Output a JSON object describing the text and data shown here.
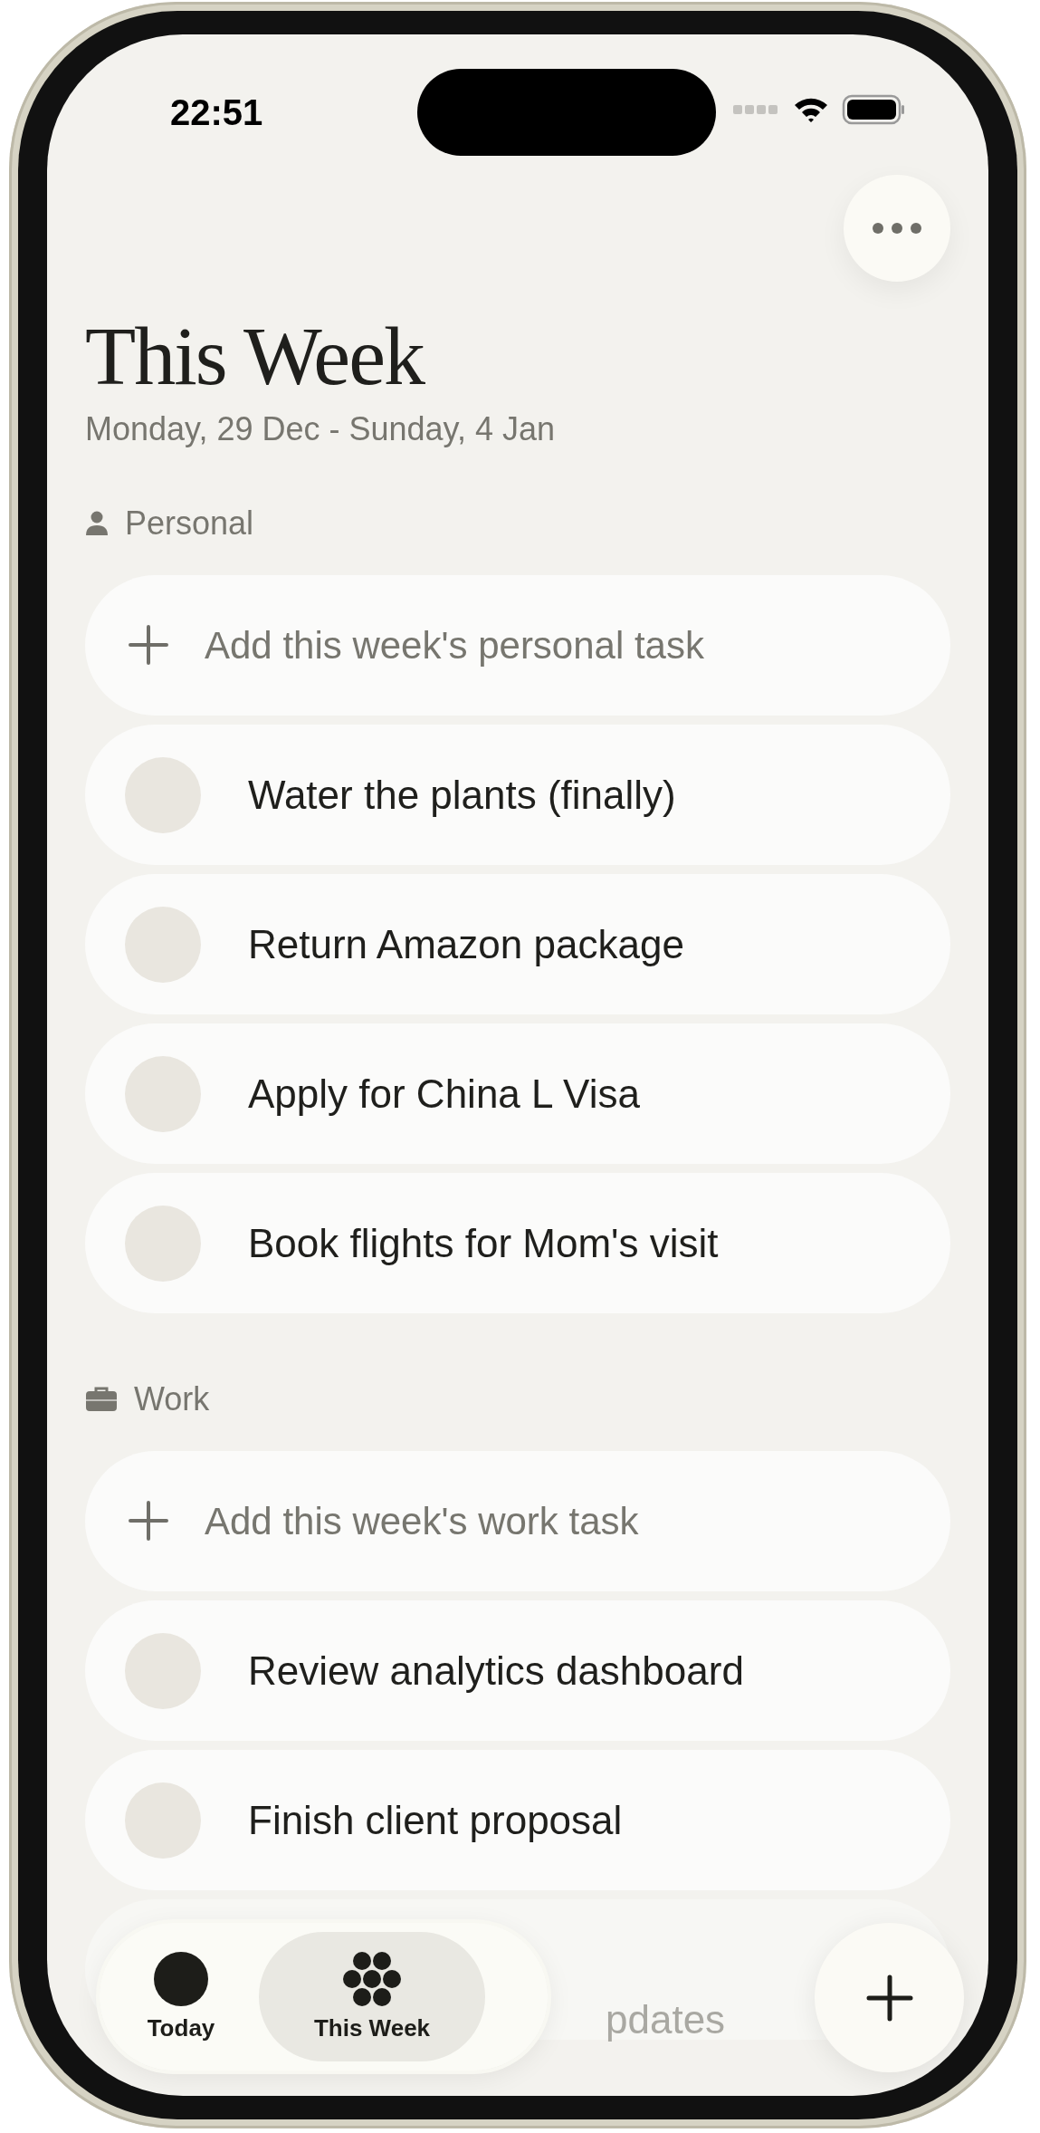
{
  "status_bar": {
    "time": "22:51"
  },
  "header": {
    "title": "This Week",
    "subtitle": "Monday, 29 Dec - Sunday, 4 Jan"
  },
  "sections": [
    {
      "kind": "personal",
      "label": "Personal",
      "placeholder": "Add this week's personal task",
      "tasks": [
        {
          "kind": "task",
          "title": "Water the plants (finally)",
          "done": false
        },
        {
          "kind": "task",
          "title": "Return Amazon package",
          "done": false
        },
        {
          "kind": "task",
          "title": "Apply for China L Visa",
          "done": false
        },
        {
          "kind": "task",
          "title": "Book flights for Mom's visit",
          "done": false
        }
      ]
    },
    {
      "kind": "work",
      "label": "Work",
      "placeholder": "Add this week's work task",
      "tasks": [
        {
          "kind": "task",
          "title": "Review analytics dashboard",
          "done": false
        },
        {
          "kind": "task",
          "title": "Finish client proposal",
          "done": false
        },
        {
          "kind": "covered",
          "title": "pdates"
        }
      ]
    }
  ],
  "tab_bar": {
    "tabs": [
      {
        "kind": "today",
        "label": "Today",
        "selected": false
      },
      {
        "kind": "week",
        "label": "This Week",
        "selected": true
      }
    ]
  }
}
